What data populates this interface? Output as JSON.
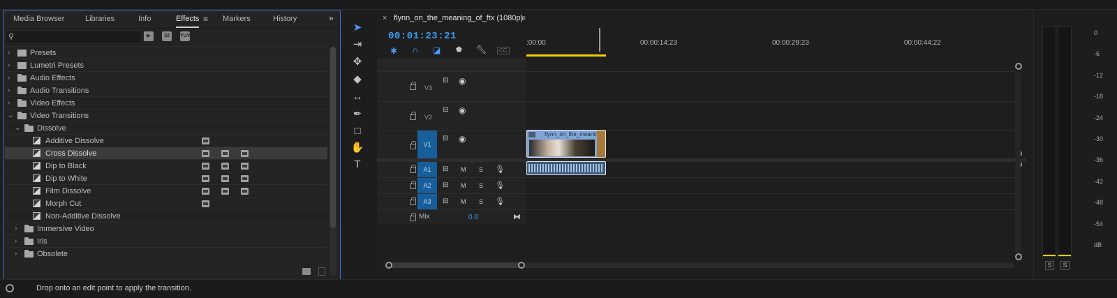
{
  "effects_panel": {
    "tabs": [
      {
        "label": "Media Browser"
      },
      {
        "label": "Libraries"
      },
      {
        "label": "Info"
      },
      {
        "label": "Effects",
        "active": true
      },
      {
        "label": "Markers"
      },
      {
        "label": "History"
      }
    ],
    "menu_icon": "hamburger-icon",
    "overflow_icon": "double-chevron-right-icon",
    "search": {
      "value": "",
      "placeholder": ""
    },
    "filter_buttons": [
      "accelerated-effects-icon",
      "32-bit-icon",
      "yuv-icon"
    ],
    "tree": [
      {
        "label": "Presets",
        "type": "preset-folder",
        "depth": 0,
        "expanded": false
      },
      {
        "label": "Lumetri Presets",
        "type": "preset-folder",
        "depth": 0,
        "expanded": false
      },
      {
        "label": "Audio Effects",
        "type": "folder",
        "depth": 0,
        "expanded": false
      },
      {
        "label": "Audio Transitions",
        "type": "folder",
        "depth": 0,
        "expanded": false
      },
      {
        "label": "Video Effects",
        "type": "folder",
        "depth": 0,
        "expanded": false
      },
      {
        "label": "Video Transitions",
        "type": "folder",
        "depth": 0,
        "expanded": true
      },
      {
        "label": "Dissolve",
        "type": "folder",
        "depth": 1,
        "expanded": true
      },
      {
        "label": "Additive Dissolve",
        "type": "transition",
        "depth": 2,
        "badges": 1
      },
      {
        "label": "Cross Dissolve",
        "type": "transition",
        "depth": 2,
        "badges": 3,
        "selected": true
      },
      {
        "label": "Dip to Black",
        "type": "transition",
        "depth": 2,
        "badges": 3
      },
      {
        "label": "Dip to White",
        "type": "transition",
        "depth": 2,
        "badges": 3
      },
      {
        "label": "Film Dissolve",
        "type": "transition",
        "depth": 2,
        "badges": 3
      },
      {
        "label": "Morph Cut",
        "type": "transition",
        "depth": 2,
        "badges": 1
      },
      {
        "label": "Non-Additive Dissolve",
        "type": "transition",
        "depth": 2,
        "badges": 0
      },
      {
        "label": "Immersive Video",
        "type": "folder",
        "depth": 1,
        "expanded": false
      },
      {
        "label": "Iris",
        "type": "folder",
        "depth": 1,
        "expanded": false
      },
      {
        "label": "Obsolete",
        "type": "folder",
        "depth": 1,
        "expanded": false
      }
    ]
  },
  "tools": [
    {
      "name": "selection-tool",
      "glyph": "➤",
      "active": true
    },
    {
      "name": "track-select-forward-tool",
      "glyph": "⇥"
    },
    {
      "name": "ripple-edit-tool",
      "glyph": "✥"
    },
    {
      "name": "razor-tool",
      "glyph": "◆"
    },
    {
      "name": "slip-tool",
      "glyph": "↔"
    },
    {
      "name": "pen-tool",
      "glyph": "✒"
    },
    {
      "name": "rectangle-tool",
      "glyph": "□"
    },
    {
      "name": "hand-tool",
      "glyph": "✋"
    },
    {
      "name": "type-tool",
      "glyph": "T"
    }
  ],
  "timeline": {
    "close_glyph": "×",
    "sequence_name": "flynn_on_the_meaning_of_ftx (1080p)",
    "timecode": "00:01:23:21",
    "ruler_labels": [
      ":00:00",
      "00:00:14:23",
      "00:00:29:23",
      "00:00:44:22"
    ],
    "cc_label": "CC",
    "video_tracks": [
      {
        "name": "V3",
        "target": ""
      },
      {
        "name": "V2",
        "target": ""
      },
      {
        "name": "V1",
        "target": "V1"
      }
    ],
    "audio_tracks": [
      {
        "name": "A1",
        "mute": "M",
        "solo": "S"
      },
      {
        "name": "A2",
        "mute": "M",
        "solo": "S"
      },
      {
        "name": "A3",
        "mute": "M",
        "solo": "S"
      }
    ],
    "mix": {
      "label": "Mix",
      "value": "0.0"
    },
    "clip_name": "flynn_on_the_meanin"
  },
  "meter": {
    "ticks": [
      "0",
      "-6",
      "-12",
      "-18",
      "-24",
      "-30",
      "-36",
      "-42",
      "-48",
      "-54",
      "dB"
    ],
    "solo_buttons": [
      "S",
      "S"
    ]
  },
  "status": {
    "message": "Drop onto an edit point to apply the transition."
  },
  "colors": {
    "accent": "#3d9cf3",
    "panel_border": "#3a74c8",
    "target_track": "#175f9a",
    "clip_video": "#7fa6d6",
    "playhead_range": "#f5d000"
  }
}
